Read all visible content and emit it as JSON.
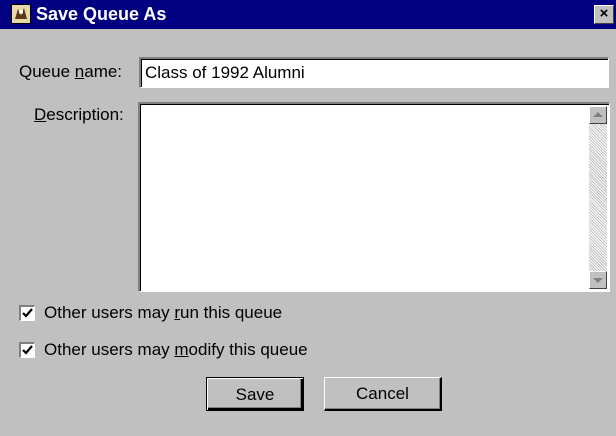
{
  "window": {
    "title": "Save Queue As",
    "close_glyph": "×",
    "app_icon": "queue-app-icon"
  },
  "form": {
    "queue_name_label": "Queue name:",
    "queue_name_value": "Class of 1992 Alumni",
    "description_label": "Description:",
    "description_value": "",
    "run_checkbox": {
      "label": "Other users may run this queue",
      "checked": true
    },
    "modify_checkbox": {
      "label": "Other users may modify this queue",
      "checked": true
    }
  },
  "buttons": {
    "save": "Save",
    "cancel": "Cancel"
  },
  "colors": {
    "titlebar": "#000080",
    "dialog_bg": "#c0c0c0"
  }
}
